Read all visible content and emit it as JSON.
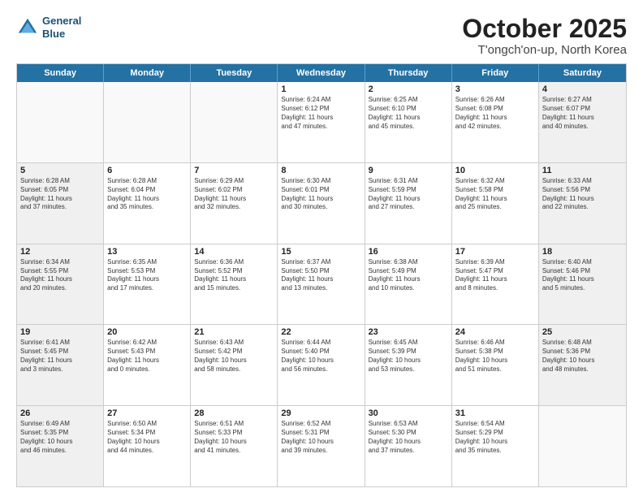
{
  "logo": {
    "line1": "General",
    "line2": "Blue"
  },
  "title": "October 2025",
  "location": "T'ongch'on-up, North Korea",
  "days_of_week": [
    "Sunday",
    "Monday",
    "Tuesday",
    "Wednesday",
    "Thursday",
    "Friday",
    "Saturday"
  ],
  "weeks": [
    [
      {
        "day": "",
        "text": ""
      },
      {
        "day": "",
        "text": ""
      },
      {
        "day": "",
        "text": ""
      },
      {
        "day": "1",
        "text": "Sunrise: 6:24 AM\nSunset: 6:12 PM\nDaylight: 11 hours\nand 47 minutes."
      },
      {
        "day": "2",
        "text": "Sunrise: 6:25 AM\nSunset: 6:10 PM\nDaylight: 11 hours\nand 45 minutes."
      },
      {
        "day": "3",
        "text": "Sunrise: 6:26 AM\nSunset: 6:08 PM\nDaylight: 11 hours\nand 42 minutes."
      },
      {
        "day": "4",
        "text": "Sunrise: 6:27 AM\nSunset: 6:07 PM\nDaylight: 11 hours\nand 40 minutes."
      }
    ],
    [
      {
        "day": "5",
        "text": "Sunrise: 6:28 AM\nSunset: 6:05 PM\nDaylight: 11 hours\nand 37 minutes."
      },
      {
        "day": "6",
        "text": "Sunrise: 6:28 AM\nSunset: 6:04 PM\nDaylight: 11 hours\nand 35 minutes."
      },
      {
        "day": "7",
        "text": "Sunrise: 6:29 AM\nSunset: 6:02 PM\nDaylight: 11 hours\nand 32 minutes."
      },
      {
        "day": "8",
        "text": "Sunrise: 6:30 AM\nSunset: 6:01 PM\nDaylight: 11 hours\nand 30 minutes."
      },
      {
        "day": "9",
        "text": "Sunrise: 6:31 AM\nSunset: 5:59 PM\nDaylight: 11 hours\nand 27 minutes."
      },
      {
        "day": "10",
        "text": "Sunrise: 6:32 AM\nSunset: 5:58 PM\nDaylight: 11 hours\nand 25 minutes."
      },
      {
        "day": "11",
        "text": "Sunrise: 6:33 AM\nSunset: 5:56 PM\nDaylight: 11 hours\nand 22 minutes."
      }
    ],
    [
      {
        "day": "12",
        "text": "Sunrise: 6:34 AM\nSunset: 5:55 PM\nDaylight: 11 hours\nand 20 minutes."
      },
      {
        "day": "13",
        "text": "Sunrise: 6:35 AM\nSunset: 5:53 PM\nDaylight: 11 hours\nand 17 minutes."
      },
      {
        "day": "14",
        "text": "Sunrise: 6:36 AM\nSunset: 5:52 PM\nDaylight: 11 hours\nand 15 minutes."
      },
      {
        "day": "15",
        "text": "Sunrise: 6:37 AM\nSunset: 5:50 PM\nDaylight: 11 hours\nand 13 minutes."
      },
      {
        "day": "16",
        "text": "Sunrise: 6:38 AM\nSunset: 5:49 PM\nDaylight: 11 hours\nand 10 minutes."
      },
      {
        "day": "17",
        "text": "Sunrise: 6:39 AM\nSunset: 5:47 PM\nDaylight: 11 hours\nand 8 minutes."
      },
      {
        "day": "18",
        "text": "Sunrise: 6:40 AM\nSunset: 5:46 PM\nDaylight: 11 hours\nand 5 minutes."
      }
    ],
    [
      {
        "day": "19",
        "text": "Sunrise: 6:41 AM\nSunset: 5:45 PM\nDaylight: 11 hours\nand 3 minutes."
      },
      {
        "day": "20",
        "text": "Sunrise: 6:42 AM\nSunset: 5:43 PM\nDaylight: 11 hours\nand 0 minutes."
      },
      {
        "day": "21",
        "text": "Sunrise: 6:43 AM\nSunset: 5:42 PM\nDaylight: 10 hours\nand 58 minutes."
      },
      {
        "day": "22",
        "text": "Sunrise: 6:44 AM\nSunset: 5:40 PM\nDaylight: 10 hours\nand 56 minutes."
      },
      {
        "day": "23",
        "text": "Sunrise: 6:45 AM\nSunset: 5:39 PM\nDaylight: 10 hours\nand 53 minutes."
      },
      {
        "day": "24",
        "text": "Sunrise: 6:46 AM\nSunset: 5:38 PM\nDaylight: 10 hours\nand 51 minutes."
      },
      {
        "day": "25",
        "text": "Sunrise: 6:48 AM\nSunset: 5:36 PM\nDaylight: 10 hours\nand 48 minutes."
      }
    ],
    [
      {
        "day": "26",
        "text": "Sunrise: 6:49 AM\nSunset: 5:35 PM\nDaylight: 10 hours\nand 46 minutes."
      },
      {
        "day": "27",
        "text": "Sunrise: 6:50 AM\nSunset: 5:34 PM\nDaylight: 10 hours\nand 44 minutes."
      },
      {
        "day": "28",
        "text": "Sunrise: 6:51 AM\nSunset: 5:33 PM\nDaylight: 10 hours\nand 41 minutes."
      },
      {
        "day": "29",
        "text": "Sunrise: 6:52 AM\nSunset: 5:31 PM\nDaylight: 10 hours\nand 39 minutes."
      },
      {
        "day": "30",
        "text": "Sunrise: 6:53 AM\nSunset: 5:30 PM\nDaylight: 10 hours\nand 37 minutes."
      },
      {
        "day": "31",
        "text": "Sunrise: 6:54 AM\nSunset: 5:29 PM\nDaylight: 10 hours\nand 35 minutes."
      },
      {
        "day": "",
        "text": ""
      }
    ]
  ]
}
